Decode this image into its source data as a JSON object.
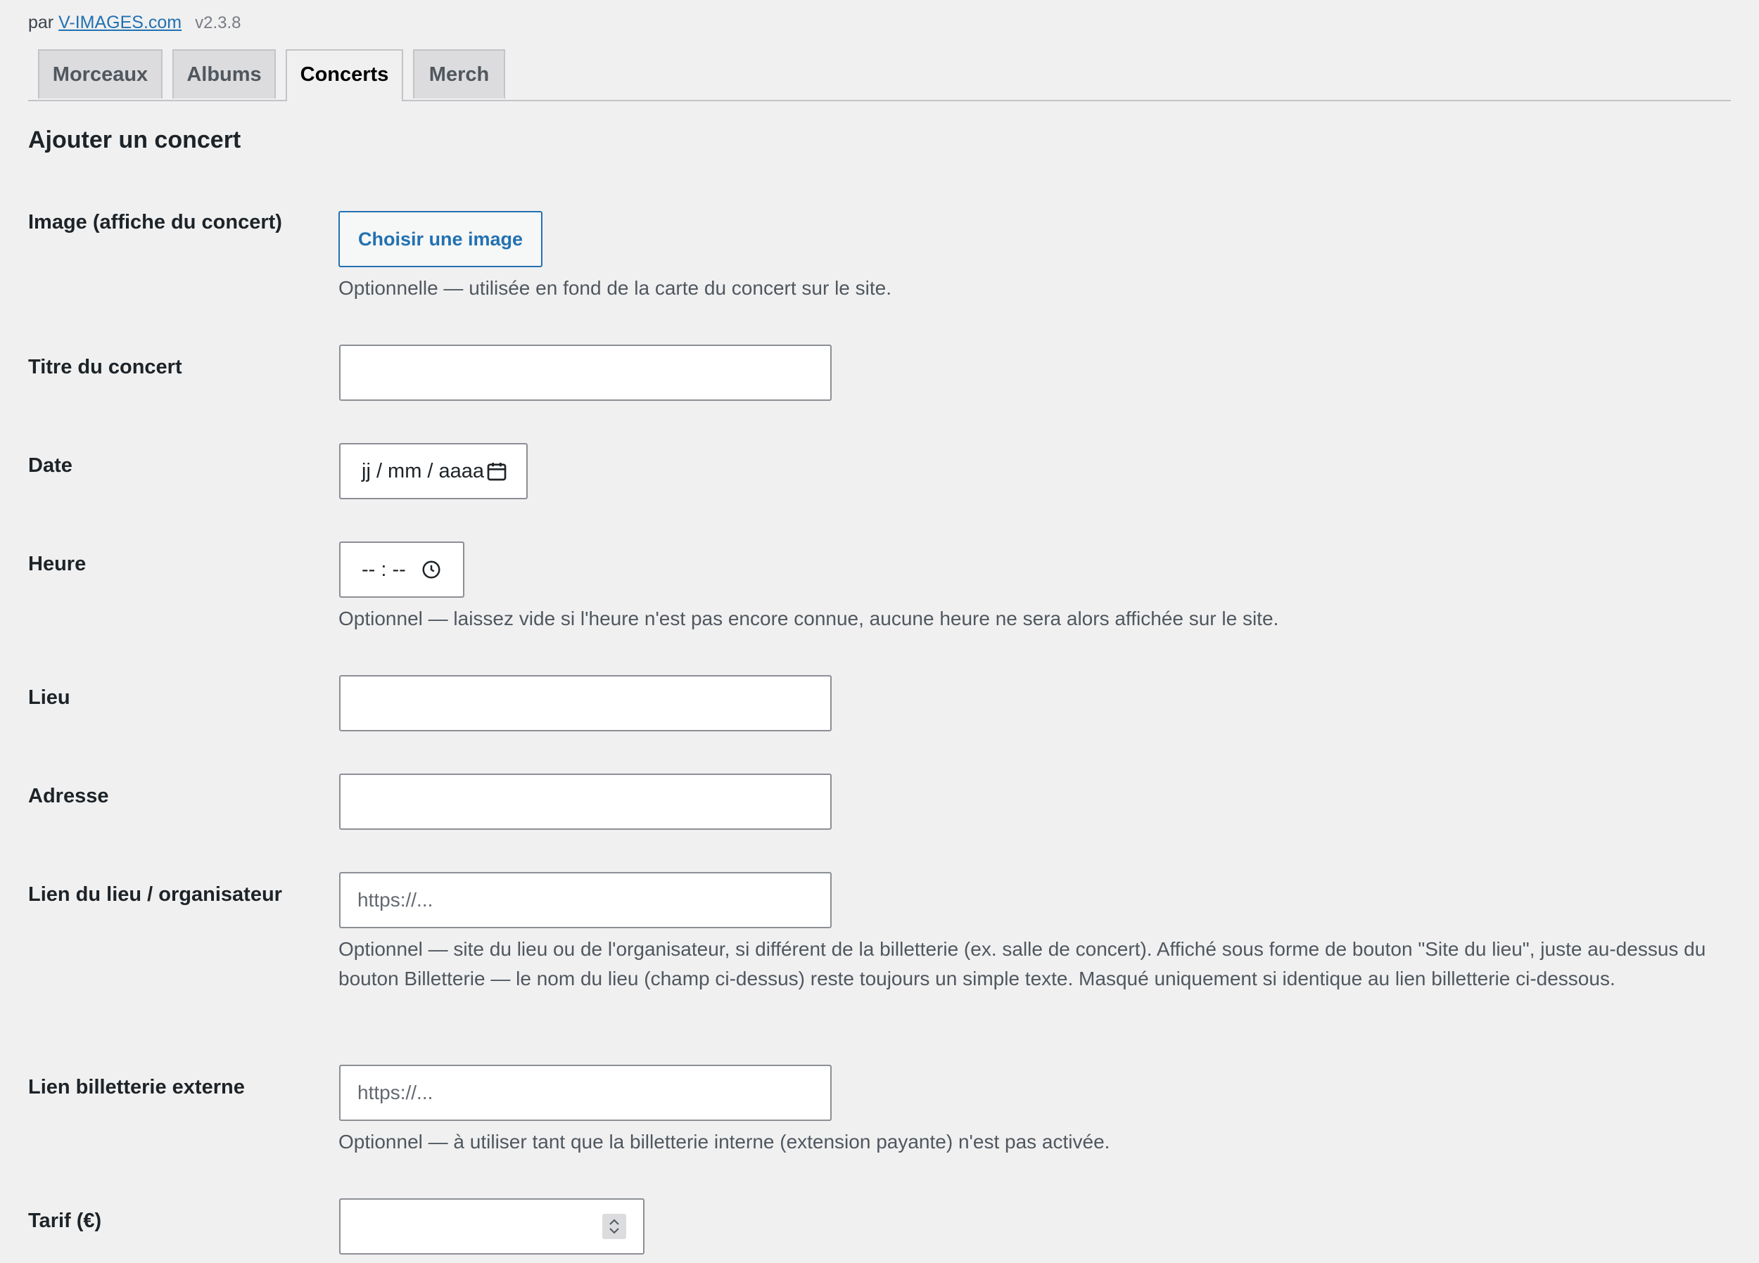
{
  "header": {
    "by_prefix": "par",
    "by_link": "V-IMAGES.com",
    "version": "v2.3.8"
  },
  "tabs": [
    {
      "label": "Morceaux",
      "active": false
    },
    {
      "label": "Albums",
      "active": false
    },
    {
      "label": "Concerts",
      "active": true
    },
    {
      "label": "Merch",
      "active": false
    }
  ],
  "section_title": "Ajouter un concert",
  "form": {
    "image": {
      "label": "Image (affiche du concert)",
      "button": "Choisir une image",
      "help": "Optionnelle — utilisée en fond de la carte du concert sur le site."
    },
    "title": {
      "label": "Titre du concert",
      "value": ""
    },
    "date": {
      "label": "Date",
      "display": "jj / mm / aaaa",
      "icon": "calendar-icon"
    },
    "time": {
      "label": "Heure",
      "display": "-- : --",
      "icon": "clock-icon",
      "help": "Optionnel — laissez vide si l'heure n'est pas encore connue, aucune heure ne sera alors affichée sur le site."
    },
    "venue": {
      "label": "Lieu",
      "value": ""
    },
    "address": {
      "label": "Adresse",
      "value": ""
    },
    "venue_link": {
      "label": "Lien du lieu / organisateur",
      "placeholder": "https://...",
      "help": "Optionnel — site du lieu ou de l'organisateur, si différent de la billetterie (ex. salle de concert). Affiché sous forme de bouton \"Site du lieu\", juste au-dessus du bouton Billetterie — le nom du lieu (champ ci-dessus) reste toujours un simple texte. Masqué uniquement si identique au lien billetterie ci-dessous."
    },
    "ticket_link": {
      "label": "Lien billetterie externe",
      "placeholder": "https://...",
      "help": "Optionnel — à utiliser tant que la billetterie interne (extension payante) n'est pas activée."
    },
    "price": {
      "label": "Tarif (€)",
      "value": ""
    }
  },
  "colors": {
    "background": "#f0f0f1",
    "link": "#2271b1",
    "tab_inactive": "#dcdcde",
    "border": "#8c8f94"
  }
}
